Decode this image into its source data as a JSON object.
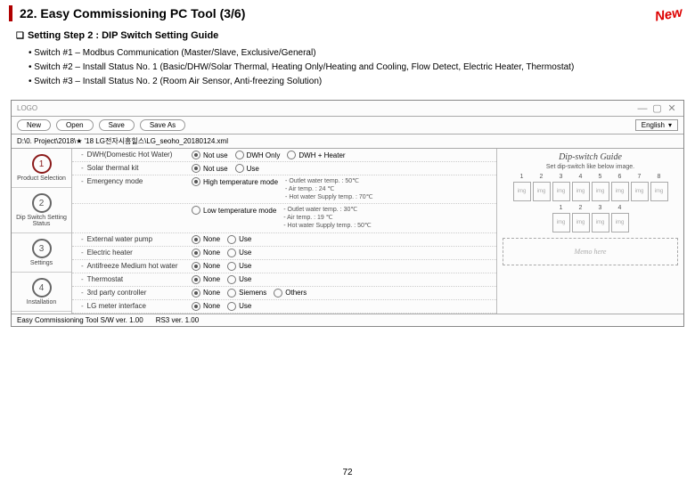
{
  "title": "22. Easy Commissioning PC Tool (3/6)",
  "new_stamp": "New",
  "subheading": "Setting Step 2 : DIP Switch Setting Guide",
  "bullets": [
    "• Switch #1 – Modbus Communication (Master/Slave, Exclusive/General)",
    "• Switch #2 – Install Status No. 1 (Basic/DHW/Solar Thermal, Heating Only/Heating and Cooling, Flow Detect, Electric Heater, Thermostat)",
    "• Switch #3 – Install Status No. 2 (Room Air Sensor, Anti-freezing Solution)"
  ],
  "app": {
    "logo": "LOGO",
    "toolbar": {
      "new": "New",
      "open": "Open",
      "save": "Save",
      "saveas": "Save As",
      "lang": "English"
    },
    "path": "D:\\0. Project\\2018\\★ '18 LG전자시흥힐스\\LG_seoho_20180124.xml",
    "steps": [
      {
        "num": "1",
        "label": "Product Selection",
        "active": true
      },
      {
        "num": "2",
        "label": "Dip Switch Setting Status",
        "active": false
      },
      {
        "num": "3",
        "label": "Settings",
        "active": false
      },
      {
        "num": "4",
        "label": "Installation",
        "active": false
      }
    ],
    "rows": [
      {
        "label": "DWH(Domestic Hot Water)",
        "opts": [
          "Not use",
          "DWH Only",
          "DWH + Heater"
        ],
        "sel": 0
      },
      {
        "label": "Solar thermal kit",
        "opts": [
          "Not use",
          "Use"
        ],
        "sel": 0
      },
      {
        "label": "Emergency mode",
        "opts": [
          "High temperature mode"
        ],
        "sel": 0,
        "sub": [
          "- Outlet water temp.        : 50℃",
          "- Air temp.                        : 24 ℃",
          "- Hot water Supply temp. : 70℃"
        ]
      },
      {
        "label": "",
        "opts": [
          "Low temperature mode"
        ],
        "sel": -1,
        "sub": [
          "- Outlet water temp.        : 30℃",
          "- Air temp.                        : 19 ℃",
          "- Hot water Supply temp. : 50℃"
        ]
      },
      {
        "label": "External water pump",
        "opts": [
          "None",
          "Use"
        ],
        "sel": 0
      },
      {
        "label": "Electric heater",
        "opts": [
          "None",
          "Use"
        ],
        "sel": 0
      },
      {
        "label": "Antifreeze Medium hot water",
        "opts": [
          "None",
          "Use"
        ],
        "sel": 0
      },
      {
        "label": "Thermostat",
        "opts": [
          "None",
          "Use"
        ],
        "sel": 0
      },
      {
        "label": "3rd party controller",
        "opts": [
          "None",
          "Siemens",
          "Others"
        ],
        "sel": 0
      },
      {
        "label": "LG meter interface",
        "opts": [
          "None",
          "Use"
        ],
        "sel": 0
      }
    ],
    "guide": {
      "title": "Dip-switch Guide",
      "sub": "Set dip-switch like below image.",
      "row1": [
        "1",
        "2",
        "3",
        "4",
        "5",
        "6",
        "7",
        "8"
      ],
      "row2": [
        "1",
        "2",
        "3",
        "4"
      ],
      "img": "img",
      "memo": "Memo here"
    },
    "status": {
      "left": "Easy Commissioning Tool S/W ver. 1.00",
      "right": "RS3 ver. 1.00"
    }
  },
  "page_num": "72"
}
